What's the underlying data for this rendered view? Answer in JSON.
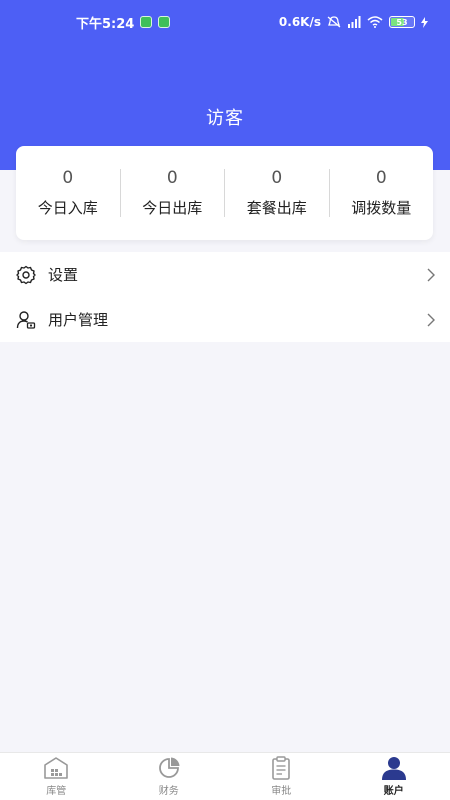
{
  "status_bar": {
    "time": "下午5:24",
    "network_speed": "0.6K/s",
    "battery_level": "53"
  },
  "header": {
    "title": "访客",
    "background_color": "#4d5ff5"
  },
  "stats": [
    {
      "value": "0",
      "label": "今日入库"
    },
    {
      "value": "0",
      "label": "今日出库"
    },
    {
      "value": "0",
      "label": "套餐出库"
    },
    {
      "value": "0",
      "label": "调拨数量"
    }
  ],
  "menu": [
    {
      "label": "设置",
      "icon": "gear-icon"
    },
    {
      "label": "用户管理",
      "icon": "user-manage-icon"
    }
  ],
  "tabbar": {
    "active_color": "#2b3a8f",
    "tabs": [
      {
        "label": "库管",
        "icon": "warehouse-icon",
        "active": false
      },
      {
        "label": "财务",
        "icon": "pie-chart-icon",
        "active": false
      },
      {
        "label": "审批",
        "icon": "clipboard-icon",
        "active": false
      },
      {
        "label": "账户",
        "icon": "person-icon",
        "active": true
      }
    ]
  }
}
